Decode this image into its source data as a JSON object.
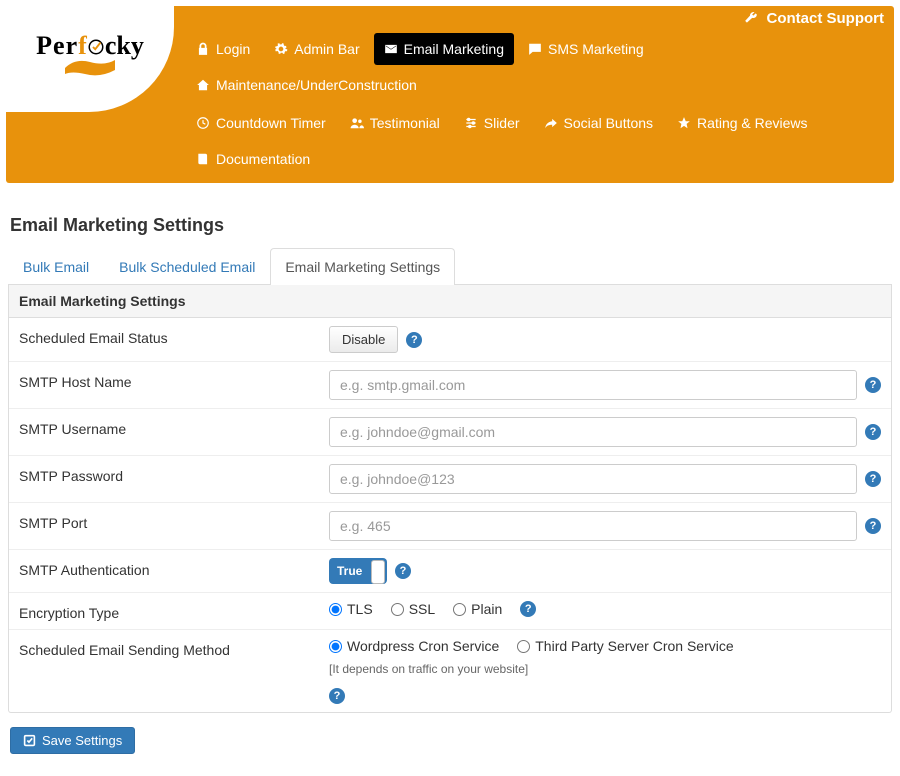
{
  "contact": {
    "label": "Contact Support"
  },
  "logo": {
    "text": "Perfecky"
  },
  "nav": {
    "row1": [
      {
        "label": "Login",
        "icon": "lock",
        "active": false
      },
      {
        "label": "Admin Bar",
        "icon": "gear",
        "active": false
      },
      {
        "label": "Email Marketing",
        "icon": "envelope",
        "active": true
      },
      {
        "label": "SMS Marketing",
        "icon": "comment",
        "active": false
      },
      {
        "label": "Maintenance/UnderConstruction",
        "icon": "home",
        "active": false
      }
    ],
    "row2": [
      {
        "label": "Countdown Timer",
        "icon": "clock",
        "active": false
      },
      {
        "label": "Testimonial",
        "icon": "users",
        "active": false
      },
      {
        "label": "Slider",
        "icon": "sliders",
        "active": false
      },
      {
        "label": "Social Buttons",
        "icon": "share",
        "active": false
      },
      {
        "label": "Rating & Reviews",
        "icon": "star",
        "active": false
      },
      {
        "label": "Documentation",
        "icon": "book",
        "active": false
      }
    ]
  },
  "page_title": "Email Marketing Settings",
  "tabs": [
    {
      "label": "Bulk Email",
      "active": false
    },
    {
      "label": "Bulk Scheduled Email",
      "active": false
    },
    {
      "label": "Email Marketing Settings",
      "active": true
    }
  ],
  "panel_title": "Email Marketing Settings",
  "fields": {
    "scheduled_status": {
      "label": "Scheduled Email Status",
      "button": "Disable"
    },
    "smtp_host": {
      "label": "SMTP Host Name",
      "placeholder": "e.g. smtp.gmail.com",
      "value": ""
    },
    "smtp_user": {
      "label": "SMTP Username",
      "placeholder": "e.g. johndoe@gmail.com",
      "value": ""
    },
    "smtp_pass": {
      "label": "SMTP Password",
      "placeholder": "e.g. johndoe@123",
      "value": ""
    },
    "smtp_port": {
      "label": "SMTP Port",
      "placeholder": "e.g. 465",
      "value": ""
    },
    "smtp_auth": {
      "label": "SMTP Authentication",
      "toggle": "True"
    },
    "encryption": {
      "label": "Encryption Type",
      "options": [
        {
          "label": "TLS",
          "checked": true
        },
        {
          "label": "SSL",
          "checked": false
        },
        {
          "label": "Plain",
          "checked": false
        }
      ]
    },
    "send_method": {
      "label": "Scheduled Email Sending Method",
      "options": [
        {
          "label": "Wordpress Cron Service",
          "checked": true
        },
        {
          "label": "Third Party Server Cron Service",
          "checked": false
        }
      ],
      "hint": "[It depends on traffic on your website]"
    }
  },
  "save_button": "Save Settings"
}
